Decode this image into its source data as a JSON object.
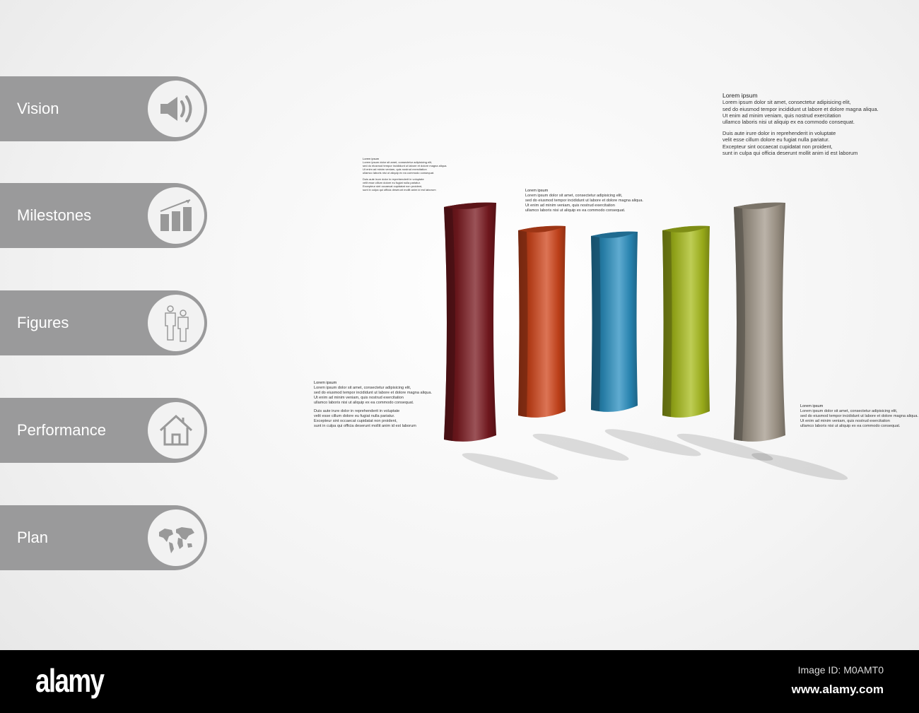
{
  "menu": [
    {
      "label": "Vision",
      "icon": "speaker-icon"
    },
    {
      "label": "Milestones",
      "icon": "bar-chart-growth-icon"
    },
    {
      "label": "Figures",
      "icon": "people-icon"
    },
    {
      "label": "Performance",
      "icon": "house-icon"
    },
    {
      "label": "Plan",
      "icon": "world-map-icon"
    }
  ],
  "cylinders": [
    {
      "color": "#7a1a20"
    },
    {
      "color": "#d0461c"
    },
    {
      "color": "#2a8fc0"
    },
    {
      "color": "#a8bc1c"
    },
    {
      "color": "#a49a8c"
    }
  ],
  "text_blocks": {
    "title": "Lorem ipsum",
    "lines1": [
      "Lorem ipsum dolor sit amet, consectetur adipisicing elit,",
      "sed do eiusmod tempor incididunt ut labore et dolore magna aliqua.",
      "Ut enim ad minim veniam, quis nostrud exercitation",
      "ullamco laboris nisi ut aliquip ex ea commodo consequat."
    ],
    "lines2": [
      "Duis aute irure dolor in reprehenderit in voluptate",
      "velit esse cillum dolore eu fugiat nulla pariatur.",
      "Excepteur sint occaecat cupidatat non proident,",
      "sunt in culpa qui officia deserunt mollit anim id est laborum"
    ]
  },
  "footer": {
    "logo": "alamy",
    "image_id": "Image ID: M0AMT0",
    "site": "www.alamy.com"
  }
}
